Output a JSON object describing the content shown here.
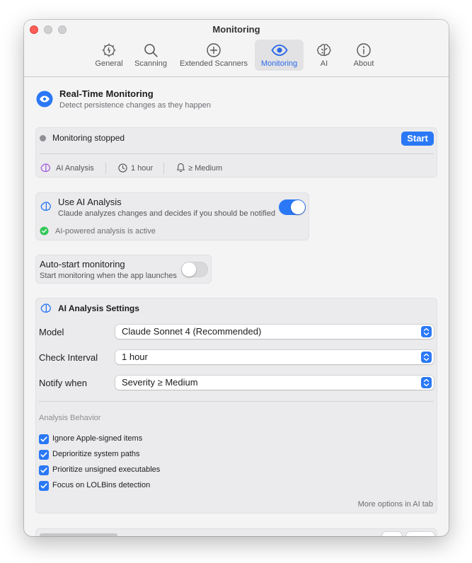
{
  "window": {
    "title": "Monitoring"
  },
  "toolbar": {
    "items": [
      {
        "label": "General",
        "icon": "gear-icon"
      },
      {
        "label": "Scanning",
        "icon": "magnifier-icon"
      },
      {
        "label": "Extended Scanners",
        "icon": "plus-circle-icon"
      },
      {
        "label": "Monitoring",
        "icon": "eye-icon",
        "active": true
      },
      {
        "label": "AI",
        "icon": "brain-icon"
      },
      {
        "label": "About",
        "icon": "info-icon"
      }
    ]
  },
  "header": {
    "title": "Real-Time Monitoring",
    "subtitle": "Detect persistence changes as they happen"
  },
  "status": {
    "text": "Monitoring stopped",
    "start_label": "Start",
    "ai_label": "AI Analysis",
    "interval": "1 hour",
    "severity": "≥ Medium"
  },
  "ai_toggle": {
    "title": "Use AI Analysis",
    "description": "Claude analyzes changes and decides if you should be notified",
    "on": true,
    "active_text": "AI-powered analysis is active"
  },
  "autostart": {
    "title": "Auto-start monitoring",
    "description": "Start monitoring when the app launches",
    "on": false
  },
  "settings": {
    "title": "AI Analysis Settings",
    "model_label": "Model",
    "model_value": "Claude Sonnet 4 (Recommended)",
    "interval_label": "Check Interval",
    "interval_value": "1 hour",
    "notify_label": "Notify when",
    "notify_value": "Severity ≥ Medium",
    "behavior_heading": "Analysis Behavior",
    "behaviors": [
      {
        "label": "Ignore Apple-signed items",
        "checked": true
      },
      {
        "label": "Deprioritize system paths",
        "checked": true
      },
      {
        "label": "Prioritize unsigned executables",
        "checked": true
      },
      {
        "label": "Focus on LOLBins detection",
        "checked": true
      }
    ],
    "more_link": "More options in AI tab"
  },
  "colors": {
    "accent": "#2a78f5",
    "status_gray": "#8e8e93",
    "success_green": "#33c759",
    "ai_purple": "#a259d9"
  }
}
